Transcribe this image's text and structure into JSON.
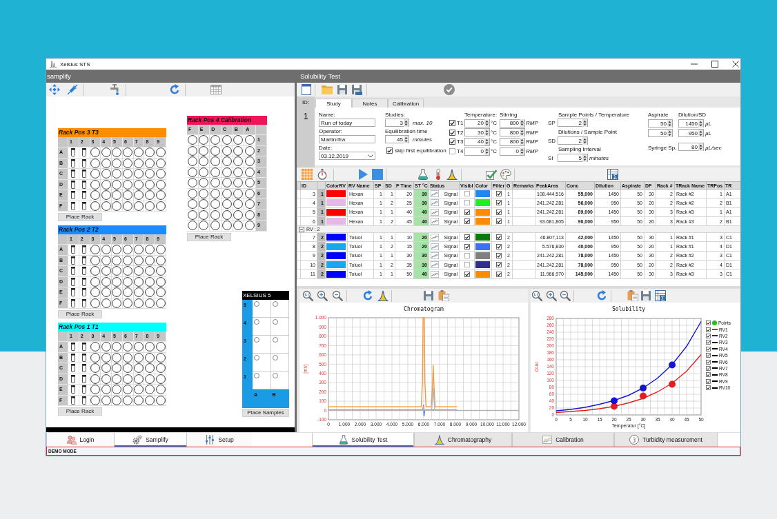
{
  "window": {
    "title": "Xelsius STS"
  },
  "samplify": {
    "title": "samplify",
    "racks": [
      {
        "title": "Rack Pos 3 T3",
        "color": "#ff8c00",
        "kind": "sample",
        "columns": [
          {
            "label": "1",
            "kind": "vial"
          },
          {
            "label": "2",
            "kind": "vial"
          },
          {
            "label": "3",
            "kind": "well"
          },
          {
            "label": "4",
            "kind": "well"
          },
          {
            "label": "5",
            "kind": "well"
          },
          {
            "label": "6",
            "kind": "well"
          },
          {
            "label": "7",
            "kind": "well"
          },
          {
            "label": "8",
            "kind": "well"
          },
          {
            "label": "9",
            "kind": "well"
          }
        ],
        "rows": [
          "A",
          "B",
          "C",
          "D",
          "E",
          "F"
        ],
        "button": "Place Rack"
      },
      {
        "title": "Rack Pos 2 T2",
        "color": "#1a8cff",
        "kind": "sample",
        "columns": [
          {
            "label": "1",
            "kind": "vial"
          },
          {
            "label": "2",
            "kind": "vial"
          },
          {
            "label": "3",
            "kind": "well"
          },
          {
            "label": "4",
            "kind": "well"
          },
          {
            "label": "5",
            "kind": "well"
          },
          {
            "label": "6",
            "kind": "well"
          },
          {
            "label": "7",
            "kind": "well"
          },
          {
            "label": "8",
            "kind": "well"
          },
          {
            "label": "9",
            "kind": "well"
          }
        ],
        "rows": [
          "A",
          "B",
          "C",
          "D",
          "E",
          "F"
        ],
        "button": "Place Rack"
      },
      {
        "title": "Rack Pos 1 T1",
        "color": "#00ffff",
        "kind": "sample",
        "columns": [
          {
            "label": "1",
            "kind": "vial"
          },
          {
            "label": "2",
            "kind": "vial"
          },
          {
            "label": "3",
            "kind": "well"
          },
          {
            "label": "4",
            "kind": "well"
          },
          {
            "label": "5",
            "kind": "well"
          },
          {
            "label": "6",
            "kind": "well"
          },
          {
            "label": "7",
            "kind": "well"
          },
          {
            "label": "8",
            "kind": "well"
          },
          {
            "label": "9",
            "kind": "well"
          }
        ],
        "rows": [
          "A",
          "B",
          "C",
          "D",
          "E",
          "F"
        ],
        "button": "Place Rack"
      },
      {
        "title": "Rack Pos 4 Calibration",
        "color": "#f0145a",
        "kind": "calibration",
        "columns": [
          {
            "label": "F",
            "kind": "well"
          },
          {
            "label": "E",
            "kind": "well"
          },
          {
            "label": "D",
            "kind": "well"
          },
          {
            "label": "C",
            "kind": "well"
          },
          {
            "label": "B",
            "kind": "well"
          },
          {
            "label": "A",
            "kind": "well"
          }
        ],
        "rows": [
          "1",
          "2",
          "3",
          "4",
          "5",
          "6",
          "7",
          "8",
          "9"
        ],
        "button": "Place Rack"
      }
    ],
    "autosampler": {
      "title": "XELSIUS 5",
      "rows": [
        "5",
        "4",
        "3",
        "2",
        "1"
      ],
      "columns": [
        "A",
        "B"
      ],
      "button": "Place Samples"
    }
  },
  "solubility_test": {
    "title": "Solubility Test",
    "id_label": "ID:",
    "id": "1",
    "tabs": [
      {
        "label": "Study",
        "selected": true
      },
      {
        "label": "Notes",
        "selected": false
      },
      {
        "label": "Calibration",
        "selected": false
      }
    ],
    "study": {
      "name": {
        "label": "Name:",
        "value": "Run of today"
      },
      "operator": {
        "label": "Operator:",
        "value": "Martinrfrw"
      },
      "date": {
        "label": "Date:",
        "value": "03.12.2019"
      },
      "studies": {
        "label": "Studies:",
        "value": "3",
        "hint": "max. 10"
      },
      "equilibration": {
        "label": "Equilibration time",
        "value": "45",
        "unit": "minutes"
      },
      "skip_first": {
        "label": "skip first equilibration",
        "checked": true
      },
      "temperature_label": "Temperature:",
      "stirring_label": "Stirring",
      "temperatures": [
        {
          "label": "T1",
          "checked": true,
          "value": "20",
          "unit": "°C",
          "stirring": "800",
          "stirring_unit": "RMP"
        },
        {
          "label": "T2",
          "checked": true,
          "value": "30",
          "unit": "°C",
          "stirring": "800",
          "stirring_unit": "RMP"
        },
        {
          "label": "T3",
          "checked": true,
          "value": "40",
          "unit": "°C",
          "stirring": "800",
          "stirring_unit": "RMP"
        },
        {
          "label": "T4",
          "checked": false,
          "value": "0",
          "unit": "°C",
          "stirring": "0",
          "stirring_unit": "RMP"
        }
      ],
      "sample_points": {
        "label": "Sample Points / Temperature",
        "short": "SP",
        "value": "2"
      },
      "dilutions": {
        "label": "Dilutions / Sample Point",
        "short": "SD",
        "value": "2"
      },
      "interval": {
        "label": "Sampling Interval",
        "short": "SI",
        "value": "5",
        "unit": "minutes"
      },
      "aspirate_label": "Aspirate",
      "dilution_label": "Dilution/SD",
      "volumes": [
        {
          "aspirate": "50",
          "dilution": "1450",
          "unit": "µL"
        },
        {
          "aspirate": "50",
          "dilution": "950",
          "unit": "µL"
        }
      ],
      "syringe": {
        "label": "Syringe Sp.",
        "value": "80",
        "unit": "µL/sec"
      }
    },
    "table": {
      "columns": [
        "ID",
        "ColorRV",
        "RV Name",
        "SP",
        "SD",
        "P Time",
        "ST °C",
        "Status",
        "Visibl",
        "Color",
        "Filter",
        "G",
        "Remarks",
        "PeakArea",
        "Conc",
        "Dilution",
        "Aspirate",
        "DF",
        "Rack #",
        "TRack Name",
        "TRPos",
        "TR"
      ],
      "groups": [
        {
          "rows": [
            {
              "id": "3",
              "group": "1",
              "rv_swatch": {
                "color": "#ff0000"
              },
              "rv_name": "Hexan",
              "sp": "1",
              "sd": "1",
              "p_time": "20",
              "st": "30",
              "status": "Signal",
              "visible": false,
              "color": "#1e88f0",
              "filter": true,
              "g": "1",
              "peak_area": "108.444,516",
              "conc": "55,000",
              "dilution": "1450",
              "aspirate": "50",
              "df": "30",
              "rack": "2",
              "track_name": "Rack #2",
              "trpos": "1",
              "tr": "A1"
            },
            {
              "id": "4",
              "group": "1",
              "rv_swatch": {
                "color": "#e6b8e6"
              },
              "rv_name": "Hexan",
              "sp": "1",
              "sd": "2",
              "p_time": "25",
              "st": "30",
              "status": "Signal",
              "visible": false,
              "color": "#22ee22",
              "filter": true,
              "g": "1",
              "peak_area": "241.242,281",
              "conc": "56,000",
              "dilution": "950",
              "aspirate": "50",
              "df": "20",
              "rack": "2",
              "track_name": "Rack #2",
              "trpos": "2",
              "tr": "B1"
            },
            {
              "id": "5",
              "group": "1",
              "rv_swatch": {
                "color": "#ff0000"
              },
              "rv_name": "Hexan",
              "sp": "1",
              "sd": "1",
              "p_time": "40",
              "st": "40",
              "status": "Signal",
              "visible": true,
              "color": "#ff8c00",
              "filter": true,
              "g": "1",
              "peak_area": "241.242,281",
              "conc": "89,000",
              "dilution": "1450",
              "aspirate": "50",
              "df": "30",
              "rack": "3",
              "track_name": "Rack #3",
              "trpos": "1",
              "tr": "A1"
            },
            {
              "id": "6",
              "group": "1",
              "rv_swatch": {
                "color": "#e6b8e6"
              },
              "rv_name": "Hexan",
              "sp": "1",
              "sd": "2",
              "p_time": "45",
              "st": "40",
              "status": "Signal",
              "visible": true,
              "color": "#ff8c00",
              "filter": true,
              "g": "1",
              "peak_area": "93.681,805",
              "conc": "90,000",
              "dilution": "950",
              "aspirate": "50",
              "df": "20",
              "rack": "3",
              "track_name": "Rack #3",
              "trpos": "2",
              "tr": "B1"
            }
          ]
        },
        {
          "header": "RV : 2",
          "expanded": true,
          "rows": [
            {
              "id": "7",
              "group": "2",
              "rv_swatch": {
                "color": "#0000ff"
              },
              "rv_name": "Toluol",
              "sp": "1",
              "sd": "1",
              "p_time": "10",
              "st": "20",
              "status": "Signal",
              "visible": true,
              "color": "#0a7a0a",
              "filter": true,
              "g": "2",
              "peak_area": "46.807,113",
              "conc": "42,000",
              "dilution": "1450",
              "aspirate": "50",
              "df": "30",
              "rack": "1",
              "track_name": "Rack #1",
              "trpos": "3",
              "tr": "C1"
            },
            {
              "id": "8",
              "group": "2",
              "rv_swatch": {
                "color": "#19a8f0"
              },
              "rv_name": "Toluol",
              "sp": "1",
              "sd": "2",
              "p_time": "15",
              "st": "20",
              "status": "Signal",
              "visible": true,
              "color": "#3f6ff5",
              "filter": true,
              "g": "2",
              "peak_area": "5.576,830",
              "conc": "40,000",
              "dilution": "950",
              "aspirate": "50",
              "df": "20",
              "rack": "1",
              "track_name": "Rack #1",
              "trpos": "4",
              "tr": "D1"
            },
            {
              "id": "9",
              "group": "2",
              "rv_swatch": {
                "color": "#0000ff"
              },
              "rv_name": "Toluol",
              "sp": "1",
              "sd": "1",
              "p_time": "30",
              "st": "30",
              "status": "Signal",
              "visible": false,
              "color": "#808080",
              "filter": true,
              "g": "2",
              "peak_area": "241.242,281",
              "conc": "78,000",
              "dilution": "1450",
              "aspirate": "50",
              "df": "30",
              "rack": "2",
              "track_name": "Rack #2",
              "trpos": "3",
              "tr": "C1"
            },
            {
              "id": "10",
              "group": "2",
              "rv_swatch": {
                "color": "#19a8f0"
              },
              "rv_name": "Toluol",
              "sp": "1",
              "sd": "2",
              "p_time": "35",
              "st": "30",
              "status": "Signal",
              "visible": false,
              "color": "#2e2e8e",
              "filter": true,
              "g": "2",
              "peak_area": "241.242,281",
              "conc": "78,000",
              "dilution": "950",
              "aspirate": "50",
              "df": "20",
              "rack": "2",
              "track_name": "Rack #2",
              "trpos": "4",
              "tr": "D1"
            },
            {
              "id": "11",
              "group": "2",
              "rv_swatch": {
                "color": "#0000ff"
              },
              "rv_name": "Toluol",
              "sp": "1",
              "sd": "1",
              "p_time": "50",
              "st": "40",
              "status": "Signal",
              "visible": true,
              "color": "#ff8c00",
              "filter": true,
              "g": "2",
              "peak_area": "11.966,970",
              "conc": "145,000",
              "dilution": "1450",
              "aspirate": "50",
              "df": "30",
              "rack": "3",
              "track_name": "Rack #3",
              "trpos": "3",
              "tr": "C1"
            }
          ]
        }
      ]
    },
    "charts": [
      {
        "chart_data": {
          "type": "line",
          "title": "Chromatogram",
          "ylabel": "[mV]",
          "xlim": [
            0,
            12000
          ],
          "ylim": [
            -100,
            1000
          ],
          "xticks": [
            0,
            {
              "value": 1000,
              "label": "1.000"
            },
            {
              "value": 2000,
              "label": "2.000"
            },
            {
              "value": 3000,
              "label": "3.000"
            },
            {
              "value": 4000,
              "label": "4.000"
            },
            {
              "value": 5000,
              "label": "5.000"
            },
            {
              "value": 6000,
              "label": "6.000"
            },
            {
              "value": 7000,
              "label": "7.000"
            },
            {
              "value": 8000,
              "label": "8.000"
            },
            {
              "value": 9000,
              "label": "9.000"
            },
            {
              "value": 10000,
              "label": "10.000"
            },
            {
              "value": 11000,
              "label": "11.000"
            },
            {
              "value": 12000,
              "label": "12.000"
            }
          ],
          "yticks": [
            -100,
            0,
            100,
            200,
            300,
            400,
            500,
            600,
            700,
            800,
            900,
            {
              "value": 1000,
              "label": "1.000"
            }
          ],
          "grid": true,
          "series": [
            {
              "color": "#f39a3c",
              "x": [
                0,
                5850,
                5920,
                5960,
                6040,
                6080,
                6150,
                6480,
                6560,
                6600,
                6640,
                6720,
                8100
              ],
              "values": [
                40,
                40,
                300,
                1000,
                1000,
                300,
                40,
                40,
                300,
                490,
                300,
                40,
                40
              ]
            },
            {
              "color": "#3f7be0",
              "x": [
                0,
                5950,
                5990,
                6020,
                6060,
                8100
              ],
              "values": [
                5,
                5,
                60,
                -60,
                5,
                5
              ]
            },
            {
              "color": "#b4b4b4",
              "x": [
                0,
                5960,
                6000,
                6040,
                6500,
                6560,
                6600,
                6640,
                6700,
                12000
              ],
              "values": [
                0,
                0,
                50,
                0,
                0,
                150,
                240,
                150,
                0,
                0
              ]
            }
          ]
        }
      },
      {
        "chart_data": {
          "type": "line",
          "title": "Solubility",
          "xlabel": "Temperatur [°C]",
          "ylabel": "Conc",
          "xlim": [
            0,
            50
          ],
          "ylim": [
            0,
            280
          ],
          "xticks": [
            0,
            5,
            10,
            15,
            20,
            25,
            30,
            35,
            40,
            45,
            50
          ],
          "yticks": [
            0,
            20,
            40,
            60,
            80,
            100,
            120,
            140,
            160,
            180,
            200,
            220,
            240,
            260,
            280
          ],
          "grid": true,
          "series": [
            {
              "color": "#e02020",
              "x": [
                0,
                5,
                10,
                15,
                20,
                25,
                30,
                35,
                40,
                45,
                50
              ],
              "values": [
                7,
                10,
                13,
                18,
                25,
                35,
                48,
                67,
                92,
                127,
                175
              ]
            },
            {
              "color": "#1414d0",
              "x": [
                0,
                5,
                10,
                15,
                20,
                25,
                30,
                35,
                40,
                45,
                50
              ],
              "values": [
                12,
                16,
                22,
                31,
                42,
                57,
                78,
                107,
                146,
                199,
                271
              ]
            },
            {
              "type": "scatter",
              "color": "#e02020",
              "x": [
                20,
                30,
                40
              ],
              "values": [
                25,
                55,
                89
              ]
            },
            {
              "type": "scatter",
              "color": "#1414d0",
              "x": [
                20,
                30,
                40
              ],
              "values": [
                41,
                78,
                145
              ]
            }
          ]
        },
        "legend_items": [
          {
            "label": "Points",
            "checked": true,
            "color": "#22c022",
            "kind": "point"
          },
          {
            "label": "RV1",
            "checked": true,
            "color": "#e02020",
            "kind": "line"
          },
          {
            "label": "RV2",
            "checked": true,
            "color": "#1414d0",
            "kind": "line"
          },
          {
            "label": "RV3",
            "checked": true,
            "color": "#000000",
            "kind": "line"
          },
          {
            "label": "RV4",
            "checked": true,
            "color": "#000000",
            "kind": "line"
          },
          {
            "label": "RV5",
            "checked": true,
            "color": "#000000",
            "kind": "line"
          },
          {
            "label": "RV6",
            "checked": true,
            "color": "#000000",
            "kind": "line"
          },
          {
            "label": "RV7",
            "checked": true,
            "color": "#000000",
            "kind": "line"
          },
          {
            "label": "RV8",
            "checked": true,
            "color": "#000000",
            "kind": "line"
          },
          {
            "label": "RV9",
            "checked": true,
            "color": "#000000",
            "kind": "line"
          },
          {
            "label": "RV10",
            "checked": true,
            "color": "#000000",
            "kind": "line"
          }
        ]
      }
    ]
  },
  "bottom_tabs": {
    "left": [
      {
        "label": "Login",
        "selected": false
      },
      {
        "label": "Samplify",
        "selected": true
      },
      {
        "label": "Setup",
        "selected": false
      }
    ],
    "right": [
      {
        "label": "Solubility Test",
        "selected": true
      },
      {
        "label": "Chromatography",
        "selected": false
      },
      {
        "label": "Calibration",
        "selected": false
      },
      {
        "label": "Turbidity measurement",
        "selected": false
      }
    ]
  },
  "status_bar": {
    "text": "DEMO MODE"
  }
}
